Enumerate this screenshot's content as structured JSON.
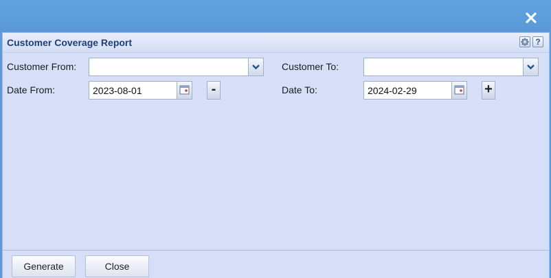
{
  "window": {
    "close_icon": "close-icon"
  },
  "panel": {
    "title": "Customer Coverage Report",
    "settings_icon": "gear-icon",
    "help_label": "?"
  },
  "form": {
    "customer_from_label": "Customer From:",
    "customer_from_value": "",
    "customer_to_label": "Customer To:",
    "customer_to_value": "",
    "date_from_label": "Date From:",
    "date_from_value": "2023-08-01",
    "date_from_step": "-",
    "date_to_label": "Date To:",
    "date_to_value": "2024-02-29",
    "date_to_step": "+"
  },
  "footer": {
    "generate_label": "Generate",
    "close_label": "Close"
  },
  "colors": {
    "titlebar": "#5b9bd9",
    "panel_bg": "#d7def7",
    "title_text": "#1e3f7a"
  }
}
